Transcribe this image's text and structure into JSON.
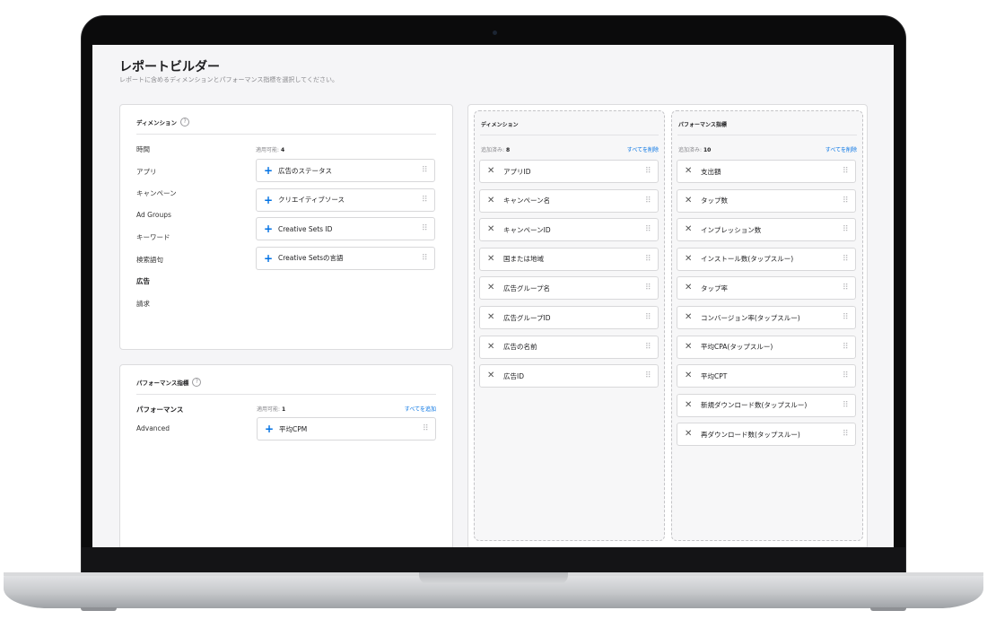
{
  "page": {
    "title": "レポートビルダー",
    "subtitle": "レポートに含めるディメンションとパフォーマンス指標を選択してください。"
  },
  "dimensions_card": {
    "title": "ディメンション",
    "help": "?",
    "categories": [
      "時間",
      "アプリ",
      "キャンペーン",
      "Ad Groups",
      "キーワード",
      "検索語句",
      "広告",
      "請求"
    ],
    "selected_category": "広告",
    "available_label": "適用可能:",
    "available_count": "4",
    "items": [
      "広告のステータス",
      "クリエイティブソース",
      "Creative Sets ID",
      "Creative Setsの言語"
    ]
  },
  "metrics_card": {
    "title": "パフォーマンス指標",
    "help": "?",
    "categories": [
      "パフォーマンス",
      "Advanced"
    ],
    "selected_category": "パフォーマンス",
    "available_label": "適用可能:",
    "available_count": "1",
    "add_all": "すべてを追加",
    "items": [
      "平均CPM"
    ]
  },
  "selected_dimensions": {
    "title": "ディメンション",
    "added_label": "追加済み:",
    "added_count": "8",
    "remove_all": "すべてを削除",
    "items": [
      "アプリID",
      "キャンペーン名",
      "キャンペーンID",
      "国または地域",
      "広告グループ名",
      "広告グループID",
      "広告の名前",
      "広告ID"
    ]
  },
  "selected_metrics": {
    "title": "パフォーマンス指標",
    "added_label": "追加済み:",
    "added_count": "10",
    "remove_all": "すべてを削除",
    "items": [
      "支出額",
      "タップ数",
      "インプレッション数",
      "インストール数(タップスルー)",
      "タップ率",
      "コンバージョン率(タップスルー)",
      "平均CPA(タップスルー)",
      "平均CPT",
      "新規ダウンロード数(タップスルー)",
      "再ダウンロード数(タップスルー)"
    ]
  },
  "icons": {
    "add": "plus-icon",
    "remove": "close-icon",
    "drag": "drag-handle-icon",
    "help": "help-icon"
  },
  "colors": {
    "accent": "#0071e3",
    "background": "#f5f5f7"
  }
}
